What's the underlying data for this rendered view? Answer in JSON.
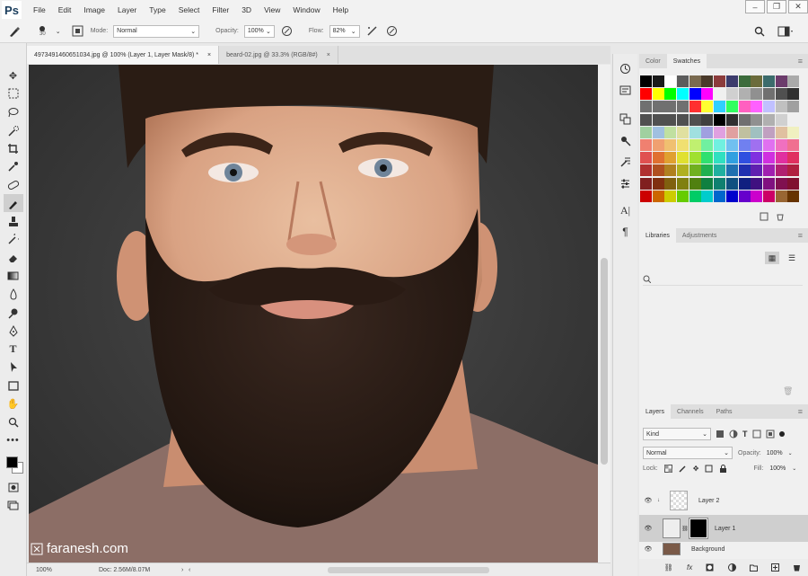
{
  "app": {
    "logo": "Ps"
  },
  "menu": [
    "File",
    "Edit",
    "Image",
    "Layer",
    "Type",
    "Select",
    "Filter",
    "3D",
    "View",
    "Window",
    "Help"
  ],
  "window_controls": [
    "–",
    "❐",
    "✕"
  ],
  "options": {
    "brush_size": "30",
    "mode_label": "Mode:",
    "mode_value": "Normal",
    "opacity_label": "Opacity:",
    "opacity_value": "100%",
    "flow_label": "Flow:",
    "flow_value": "82%"
  },
  "tabs": [
    {
      "label": "4973491460651034.jpg @ 100% (Layer 1, Layer Mask/8) *",
      "close": "×"
    },
    {
      "label": "beard-02.jpg @ 33.3% (RGB/8#)",
      "close": "×"
    }
  ],
  "status": {
    "zoom": "100%",
    "doc": "Doc: 2.56M/8.07M"
  },
  "watermark": "faranesh.com",
  "color_panel": {
    "tabs": [
      "Color",
      "Swatches"
    ]
  },
  "swatch_colors": [
    "#000000",
    "#1a1a1a",
    "#ffffff",
    "#5c5c5c",
    "#7a6a50",
    "#4a3a2a",
    "#8c3c3c",
    "#3c3c6c",
    "#3c6c3c",
    "#6c6c3c",
    "#3c6c6c",
    "#6c3c6c",
    "#aaaaaa",
    "#ff0000",
    "#ffff00",
    "#00ff00",
    "#00ffff",
    "#0000ff",
    "#ff00ff",
    "#f0f0f0",
    "#d0d0d0",
    "#b0b0b0",
    "#909090",
    "#707070",
    "#505050",
    "#303030",
    "#707070",
    "#707070",
    "#707070",
    "#707070",
    "#ff3030",
    "#ffff30",
    "#30d0ff",
    "#30ff60",
    "#ff60c0",
    "#ff60ff",
    "#c0c0ff",
    "#c0c0c0",
    "#a0a0a0",
    "#505050",
    "#505050",
    "#505050",
    "#505050",
    "#505050",
    "#404040",
    "#000000",
    "#303030",
    "#707070",
    "#909090",
    "#b0b0b0",
    "#d0d0d0",
    "#f0f0f0",
    "#a0d0a0",
    "#a0c0e0",
    "#c0e0a0",
    "#e0e0a0",
    "#a0e0e0",
    "#a0a0e0",
    "#e0a0e0",
    "#e0a0a0",
    "#c0c0a0",
    "#a0c0c0",
    "#c0a0c0",
    "#e0c0a0",
    "#f0f0c0",
    "#f08070",
    "#f0a070",
    "#f0c070",
    "#f0e070",
    "#c0f070",
    "#70f0a0",
    "#70f0e0",
    "#70c0f0",
    "#7080f0",
    "#a070f0",
    "#e070f0",
    "#f070c0",
    "#f07090",
    "#e05050",
    "#e07030",
    "#e0a030",
    "#e0e030",
    "#a0e030",
    "#30e070",
    "#30e0c0",
    "#30a0e0",
    "#3050e0",
    "#8030e0",
    "#d030e0",
    "#e030a0",
    "#e03060",
    "#b03030",
    "#b05020",
    "#b08020",
    "#b0b020",
    "#70b020",
    "#20b050",
    "#20b0a0",
    "#2070b0",
    "#2030b0",
    "#6020b0",
    "#a020b0",
    "#b02070",
    "#b02040",
    "#802020",
    "#803010",
    "#806010",
    "#808010",
    "#508010",
    "#108040",
    "#108070",
    "#105080",
    "#102080",
    "#401080",
    "#801080",
    "#801050",
    "#801030",
    "#cc0000",
    "#cc6600",
    "#cccc00",
    "#66cc00",
    "#00cc66",
    "#00cccc",
    "#0066cc",
    "#0000cc",
    "#6600cc",
    "#cc00cc",
    "#cc0066",
    "#996633",
    "#663300"
  ],
  "libraries_panel": {
    "tabs": [
      "Libraries",
      "Adjustments"
    ]
  },
  "layers_panel": {
    "tabs": [
      "Layers",
      "Channels",
      "Paths"
    ],
    "kind": "Kind",
    "blend": "Normal",
    "opacity_label": "Opacity:",
    "opacity_value": "100%",
    "lock_label": "Lock:",
    "fill_label": "Fill:",
    "fill_value": "100%",
    "layers": [
      {
        "name": "Layer 2"
      },
      {
        "name": "Layer 1"
      },
      {
        "name": "Background"
      }
    ]
  }
}
